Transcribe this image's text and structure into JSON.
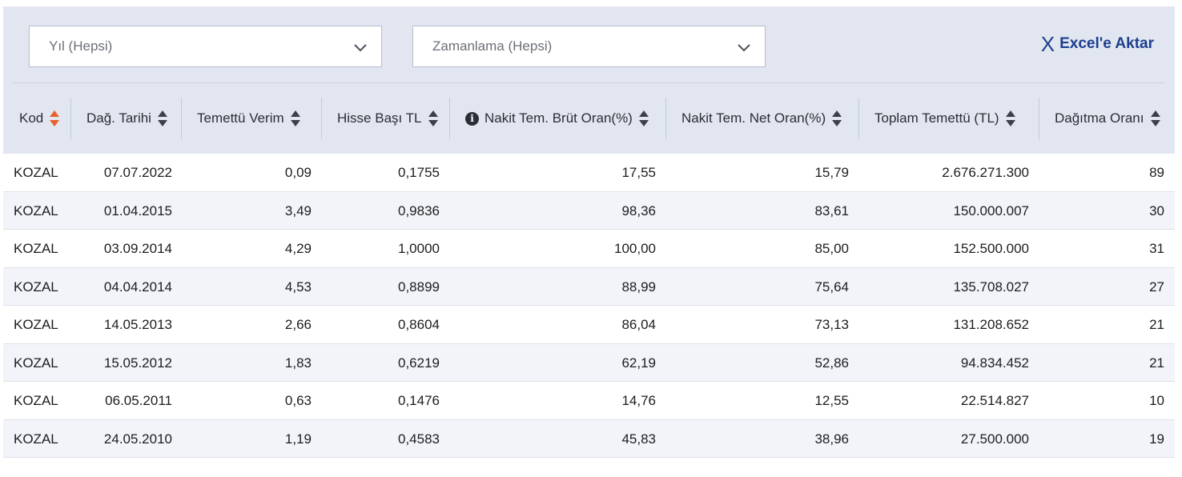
{
  "filters": {
    "year_select": "Yıl (Hepsi)",
    "timing_select": "Zamanlama (Hepsi)",
    "export_label": "Excel'e Aktar",
    "export_icon": "X"
  },
  "table": {
    "columns": [
      "Kod",
      "Dağ. Tarihi",
      "Temettü Verim",
      "Hisse Başı TL",
      "Nakit Tem. Brüt Oran(%)",
      "Nakit Tem. Net Oran(%)",
      "Toplam Temettü (TL)",
      "Dağıtma Oranı"
    ],
    "active_sort_color": "#e8632b",
    "rows": [
      [
        "KOZAL",
        "07.07.2022",
        "0,09",
        "0,1755",
        "17,55",
        "15,79",
        "2.676.271.300",
        "89"
      ],
      [
        "KOZAL",
        "01.04.2015",
        "3,49",
        "0,9836",
        "98,36",
        "83,61",
        "150.000.007",
        "30"
      ],
      [
        "KOZAL",
        "03.09.2014",
        "4,29",
        "1,0000",
        "100,00",
        "85,00",
        "152.500.000",
        "31"
      ],
      [
        "KOZAL",
        "04.04.2014",
        "4,53",
        "0,8899",
        "88,99",
        "75,64",
        "135.708.027",
        "27"
      ],
      [
        "KOZAL",
        "14.05.2013",
        "2,66",
        "0,8604",
        "86,04",
        "73,13",
        "131.208.652",
        "21"
      ],
      [
        "KOZAL",
        "15.05.2012",
        "1,83",
        "0,6219",
        "62,19",
        "52,86",
        "94.834.452",
        "21"
      ],
      [
        "KOZAL",
        "06.05.2011",
        "0,63",
        "0,1476",
        "14,76",
        "12,55",
        "22.514.827",
        "10"
      ],
      [
        "KOZAL",
        "24.05.2010",
        "1,19",
        "0,4583",
        "45,83",
        "38,96",
        "27.500.000",
        "19"
      ]
    ]
  }
}
